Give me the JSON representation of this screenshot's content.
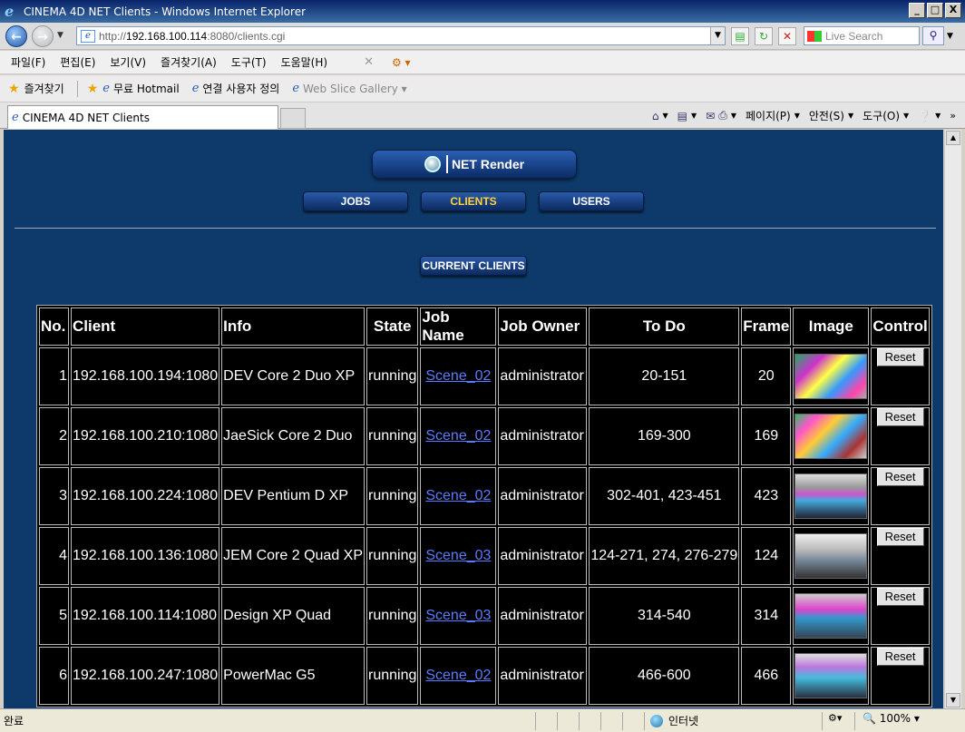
{
  "window": {
    "title": "CINEMA 4D NET Clients - Windows Internet Explorer",
    "min": "_",
    "max": "□",
    "close": "X"
  },
  "address": {
    "url_prefix": "http://",
    "url_host": "192.168.100.114",
    "url_rest": ":8080/clients.cgi",
    "search_placeholder": "Live Search"
  },
  "menu": [
    "파일(F)",
    "편집(E)",
    "보기(V)",
    "즐겨찾기(A)",
    "도구(T)",
    "도움말(H)"
  ],
  "favorites": {
    "label": "즐겨찾기",
    "items": [
      "무료 Hotmail",
      "연결 사용자 정의",
      "Web Slice Gallery"
    ]
  },
  "tab": {
    "label": "CINEMA 4D NET Clients"
  },
  "commandbar": {
    "page": "페이지(P)",
    "safety": "안전(S)",
    "tools": "도구(O)"
  },
  "app": {
    "logo": "NET Render",
    "nav": [
      "JOBS",
      "CLIENTS",
      "USERS"
    ],
    "active_nav": "CLIENTS",
    "current_clients": "CURRENT CLIENTS"
  },
  "table": {
    "headers": [
      "No.",
      "Client",
      "Info",
      "State",
      "Job Name",
      "Job Owner",
      "To Do",
      "Frame",
      "Image",
      "Control"
    ],
    "rows": [
      {
        "no": "1",
        "client": "192.168.100.194:1080",
        "info": "DEV Core 2 Duo XP",
        "state": "running",
        "job": "Scene_02",
        "owner": "administrator",
        "todo": "20-151",
        "frame": "20",
        "reset": "Reset"
      },
      {
        "no": "2",
        "client": "192.168.100.210:1080",
        "info": "JaeSick Core 2 Duo",
        "state": "running",
        "job": "Scene_02",
        "owner": "administrator",
        "todo": "169-300",
        "frame": "169",
        "reset": "Reset"
      },
      {
        "no": "3",
        "client": "192.168.100.224:1080",
        "info": "DEV Pentium D XP",
        "state": "running",
        "job": "Scene_02",
        "owner": "administrator",
        "todo": "302-401, 423-451",
        "frame": "423",
        "reset": "Reset"
      },
      {
        "no": "4",
        "client": "192.168.100.136:1080",
        "info": "JEM Core 2 Quad XP",
        "state": "running",
        "job": "Scene_03",
        "owner": "administrator",
        "todo": "124-271, 274, 276-279",
        "frame": "124",
        "reset": "Reset"
      },
      {
        "no": "5",
        "client": "192.168.100.114:1080",
        "info": "Design XP Quad",
        "state": "running",
        "job": "Scene_03",
        "owner": "administrator",
        "todo": "314-540",
        "frame": "314",
        "reset": "Reset"
      },
      {
        "no": "6",
        "client": "192.168.100.247:1080",
        "info": "PowerMac G5",
        "state": "running",
        "job": "Scene_02",
        "owner": "administrator",
        "todo": "466-600",
        "frame": "466",
        "reset": "Reset"
      }
    ]
  },
  "status": {
    "text": "완료",
    "zone": "인터넷",
    "zoom": "100%"
  },
  "colors": {
    "page_bg": "#0d3a6a",
    "active_nav": "#ffd43a",
    "link": "#5b7bff"
  }
}
